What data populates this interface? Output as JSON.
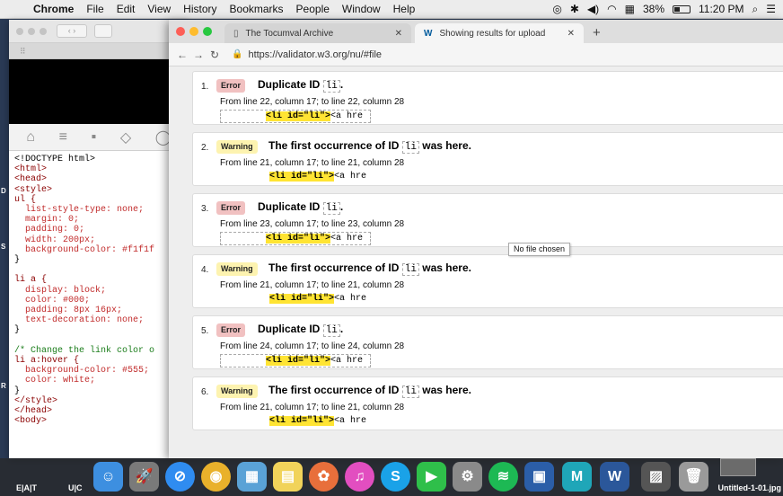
{
  "menubar": {
    "app": "Chrome",
    "items": [
      "File",
      "Edit",
      "View",
      "History",
      "Bookmarks",
      "People",
      "Window",
      "Help"
    ],
    "battery": "38%",
    "time": "11:20 PM"
  },
  "desktop": {
    "letters": [
      "D",
      "S",
      "R"
    ],
    "dock_labels": [
      "E|A|T",
      "U|C"
    ],
    "file_label": "Untitled-1-01.jpg"
  },
  "editor": {
    "code": [
      {
        "t": "<!DOCTYPE html>",
        "c": ""
      },
      {
        "t": "<html>",
        "c": "tag"
      },
      {
        "t": "<head>",
        "c": "tag"
      },
      {
        "t": "<style>",
        "c": "tag"
      },
      {
        "t": "ul {",
        "c": "tag"
      },
      {
        "t": "  list-style-type: none;",
        "c": "prop"
      },
      {
        "t": "  margin: 0;",
        "c": "prop"
      },
      {
        "t": "  padding: 0;",
        "c": "prop"
      },
      {
        "t": "  width: 200px;",
        "c": "prop"
      },
      {
        "t": "  background-color: #f1f1f",
        "c": "prop"
      },
      {
        "t": "}",
        "c": ""
      },
      {
        "t": "",
        "c": ""
      },
      {
        "t": "li a {",
        "c": "tag"
      },
      {
        "t": "  display: block;",
        "c": "prop"
      },
      {
        "t": "  color: #000;",
        "c": "prop"
      },
      {
        "t": "  padding: 8px 16px;",
        "c": "prop"
      },
      {
        "t": "  text-decoration: none;",
        "c": "prop"
      },
      {
        "t": "}",
        "c": ""
      },
      {
        "t": "",
        "c": ""
      },
      {
        "t": "/* Change the link color o",
        "c": "cmt"
      },
      {
        "t": "li a:hover {",
        "c": "tag"
      },
      {
        "t": "  background-color: #555;",
        "c": "prop"
      },
      {
        "t": "  color: white;",
        "c": "prop"
      },
      {
        "t": "}",
        "c": ""
      },
      {
        "t": "</style>",
        "c": "tag"
      },
      {
        "t": "</head>",
        "c": "tag"
      },
      {
        "t": "<body>",
        "c": "tag"
      }
    ]
  },
  "browser": {
    "tabs": [
      {
        "title": "The Tocumval Archive",
        "active": false
      },
      {
        "title": "Showing results for uploaded fil",
        "active": true
      }
    ],
    "url": "https://validator.w3.org/nu/#file"
  },
  "messages": [
    {
      "num": "1.",
      "type": "Error",
      "pre": "Duplicate ID",
      "code": "li",
      "post": ".",
      "location": "From line 22, column 17; to line 22, column 28",
      "extract_hl": "<li id=\"li\">",
      "extract_rest": "<a hre",
      "boxed": true
    },
    {
      "num": "2.",
      "type": "Warning",
      "pre": "The first occurrence of ID",
      "code": "li",
      "post": "was here.",
      "location": "From line 21, column 17; to line 21, column 28",
      "extract_hl": "<li id=\"li\">",
      "extract_rest": "<a hre",
      "boxed": false
    },
    {
      "num": "3.",
      "type": "Error",
      "pre": "Duplicate ID",
      "code": "li",
      "post": ".",
      "location": "From line 23, column 17; to line 23, column 28",
      "extract_hl": "<li id=\"li\">",
      "extract_rest": "<a hre",
      "boxed": true
    },
    {
      "num": "4.",
      "type": "Warning",
      "pre": "The first occurrence of ID",
      "code": "li",
      "post": "was here.",
      "location": "From line 21, column 17; to line 21, column 28",
      "extract_hl": "<li id=\"li\">",
      "extract_rest": "<a hre",
      "boxed": false
    },
    {
      "num": "5.",
      "type": "Error",
      "pre": "Duplicate ID",
      "code": "li",
      "post": ".",
      "location": "From line 24, column 17; to line 24, column 28",
      "extract_hl": "<li id=\"li\">",
      "extract_rest": "<a hre",
      "boxed": true
    },
    {
      "num": "6.",
      "type": "Warning",
      "pre": "The first occurrence of ID",
      "code": "li",
      "post": "was here.",
      "location": "From line 21, column 17; to line 21, column 28",
      "extract_hl": "<li id=\"li\">",
      "extract_rest": "<a hre",
      "boxed": false
    }
  ],
  "tooltip": "No file chosen",
  "dock": {
    "apps": [
      {
        "name": "finder-icon",
        "glyph": "☺",
        "bg": "#3d8fe0"
      },
      {
        "name": "launchpad-icon",
        "glyph": "🚀",
        "bg": "#7a7a7a"
      },
      {
        "name": "safari-icon",
        "glyph": "⊘",
        "bg": "#2f8cf0"
      },
      {
        "name": "chrome-icon",
        "glyph": "◉",
        "bg": "#e9b12b"
      },
      {
        "name": "preview-icon",
        "glyph": "▦",
        "bg": "#5aa2d6"
      },
      {
        "name": "stickies-icon",
        "glyph": "▤",
        "bg": "#f1d35a"
      },
      {
        "name": "photos-icon",
        "glyph": "✿",
        "bg": "#e86f3b"
      },
      {
        "name": "itunes-icon",
        "glyph": "♫",
        "bg": "#e24ec0"
      },
      {
        "name": "skype-icon",
        "glyph": "S",
        "bg": "#1aa2e8"
      },
      {
        "name": "facetime-icon",
        "glyph": "▶",
        "bg": "#2fbf4a"
      },
      {
        "name": "system-preferences-icon",
        "glyph": "⚙",
        "bg": "#8a8a8a"
      },
      {
        "name": "spotify-icon",
        "glyph": "≋",
        "bg": "#1db954"
      },
      {
        "name": "screen-icon",
        "glyph": "▣",
        "bg": "#2b5ea8"
      },
      {
        "name": "maya-icon",
        "glyph": "M",
        "bg": "#1fa6b8"
      },
      {
        "name": "word-icon",
        "glyph": "W",
        "bg": "#2b579a"
      },
      {
        "name": "image-viewer-icon",
        "glyph": "▨",
        "bg": "#555555"
      },
      {
        "name": "trash-icon",
        "glyph": "🗑",
        "bg": "#9a9a9a"
      }
    ]
  }
}
